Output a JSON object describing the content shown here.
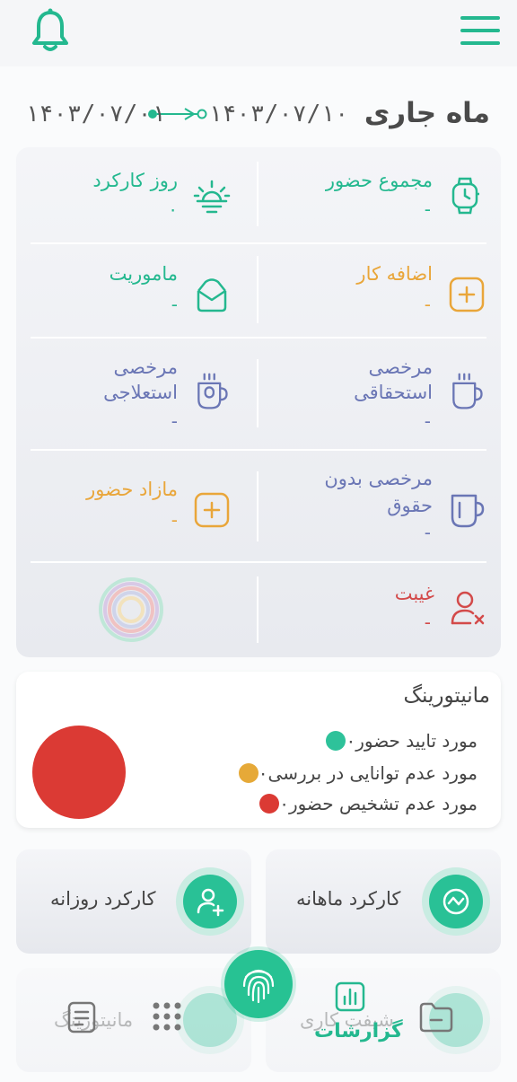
{
  "header": {
    "bell_icon": "bell-icon",
    "menu_icon": "hamburger-menu-icon"
  },
  "period": {
    "title": "ماه جاری",
    "start_date": "۱۴۰۳/۰۷/۰۱",
    "end_date": "۱۴۰۳/۰۷/۱۰"
  },
  "stats": {
    "total_presence": {
      "label": "مجموع حضور",
      "value": "-"
    },
    "work_days": {
      "label": "روز کارکرد",
      "value": "۰"
    },
    "overtime": {
      "label": "اضافه کار",
      "value": "-"
    },
    "mission": {
      "label": "ماموریت",
      "value": "-"
    },
    "entitled_leave": {
      "label_line1": "مرخصی",
      "label_line2": "استحقاقی",
      "value": "-"
    },
    "sick_leave": {
      "label_line1": "مرخصی",
      "label_line2": "استعلاجی",
      "value": "-"
    },
    "unpaid_leave": {
      "label_line1": "مرخصی بدون",
      "label_line2": "حقوق",
      "value": "-"
    },
    "extra_presence": {
      "label": "مازاد حضور",
      "value": "-"
    },
    "absence": {
      "label": "غیبت",
      "value": "-"
    }
  },
  "monitoring": {
    "title": "مانیتورینگ",
    "legend": [
      {
        "count": "۰",
        "text": "مورد تایید حضور",
        "color": "#2ec29a"
      },
      {
        "count": "۰",
        "text": "مورد عدم توانایی در بررسی",
        "color": "#e6a938"
      },
      {
        "count": "۰",
        "text": "مورد عدم تشخیص حضور",
        "color": "#db3a34"
      }
    ]
  },
  "tiles": {
    "monthly": {
      "label": "کارکرد ماهانه"
    },
    "daily": {
      "label": "کارکرد روزانه"
    },
    "shift": {
      "label": "شیفت کاری"
    },
    "monitor": {
      "label": "مانیتورینگ"
    }
  },
  "nav": {
    "reports_label": "گزارشات"
  },
  "colors": {
    "accent": "#24b88f",
    "orange": "#e9a63a",
    "purple": "#6a76b5",
    "red": "#d34a4a"
  }
}
